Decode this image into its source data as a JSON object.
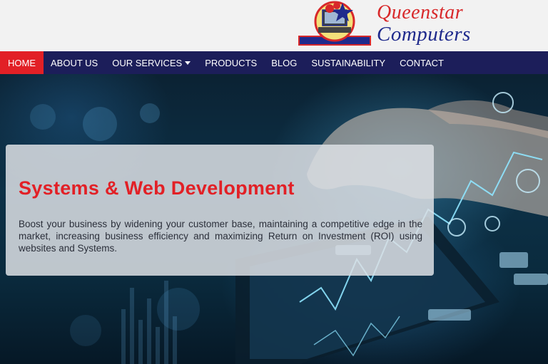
{
  "logo": {
    "line1": "Queenstar",
    "line2": "Computers",
    "emblem_icon": "queenstar-star-computer-emblem",
    "colors": {
      "red": "#d8282a",
      "blue": "#1f2a8c"
    }
  },
  "nav": {
    "items": [
      {
        "label": "HOME",
        "active": true
      },
      {
        "label": "ABOUT US"
      },
      {
        "label": "OUR SERVICES",
        "dropdown": true
      },
      {
        "label": "PRODUCTS"
      },
      {
        "label": "BLOG"
      },
      {
        "label": "SUSTAINABILITY"
      },
      {
        "label": "CONTACT"
      }
    ],
    "colors": {
      "background": "#1c1e5a",
      "active": "#e22026",
      "text": "#ffffff"
    }
  },
  "hero": {
    "title": "Systems & Web Development",
    "text": "Boost your business by widening your customer base, maintaining a competitive edge in the market, increasing business efficiency and maximizing Return on Investment (ROI) using websites and Systems.",
    "colors": {
      "title": "#e22026",
      "card": "#dcdfe3"
    }
  }
}
